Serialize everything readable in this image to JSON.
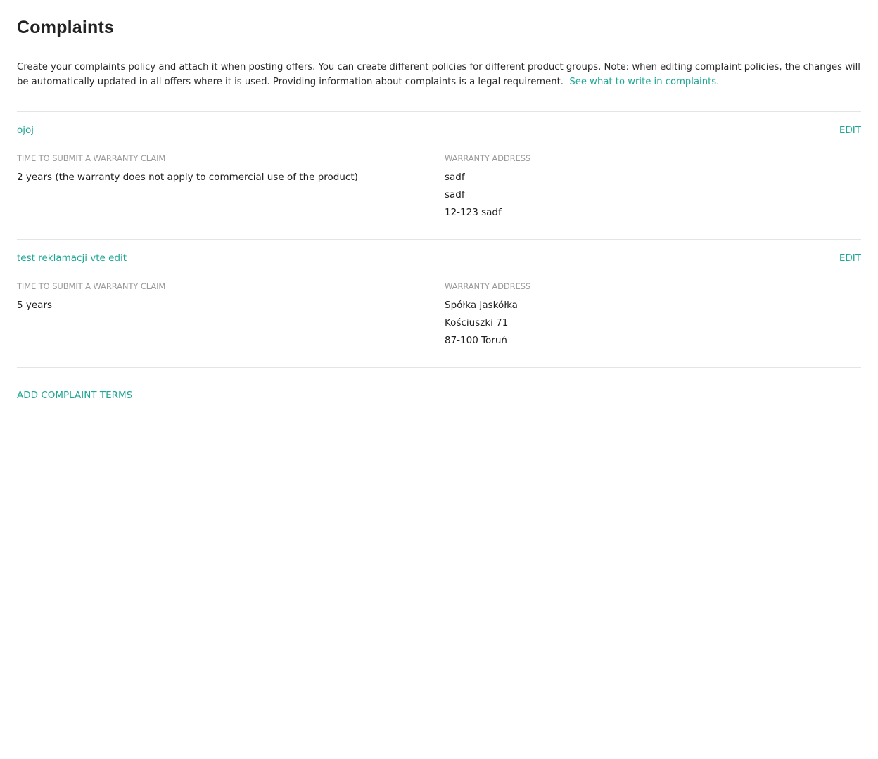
{
  "page": {
    "title": "Complaints",
    "description": "Create your complaints policy and attach it when posting offers. You can create different policies for different product groups. Note: when editing complaint policies, the changes will be automatically updated in all offers where it is used. Providing information about complaints is a legal requirement.",
    "help_link": "See what to write in complaints."
  },
  "policies": [
    {
      "name": "ojoj",
      "edit_label": "EDIT",
      "time_label": "TIME TO SUBMIT A WARRANTY CLAIM",
      "time_value": "2 years (the warranty does not apply to commercial use of the product)",
      "address_label": "WARRANTY ADDRESS",
      "address_lines": [
        "sadf",
        "sadf",
        "12-123 sadf"
      ]
    },
    {
      "name": "test reklamacji vte edit",
      "edit_label": "EDIT",
      "time_label": "TIME TO SUBMIT A WARRANTY CLAIM",
      "time_value": "5 years",
      "address_label": "WARRANTY ADDRESS",
      "address_lines": [
        "Spółka Jaskółka",
        "Kościuszki 71",
        "87-100 Toruń"
      ]
    }
  ],
  "actions": {
    "add_label": "ADD COMPLAINT TERMS"
  },
  "colors": {
    "accent": "#1da794",
    "label": "#9a9a9a",
    "divider": "#e4e4e4"
  }
}
